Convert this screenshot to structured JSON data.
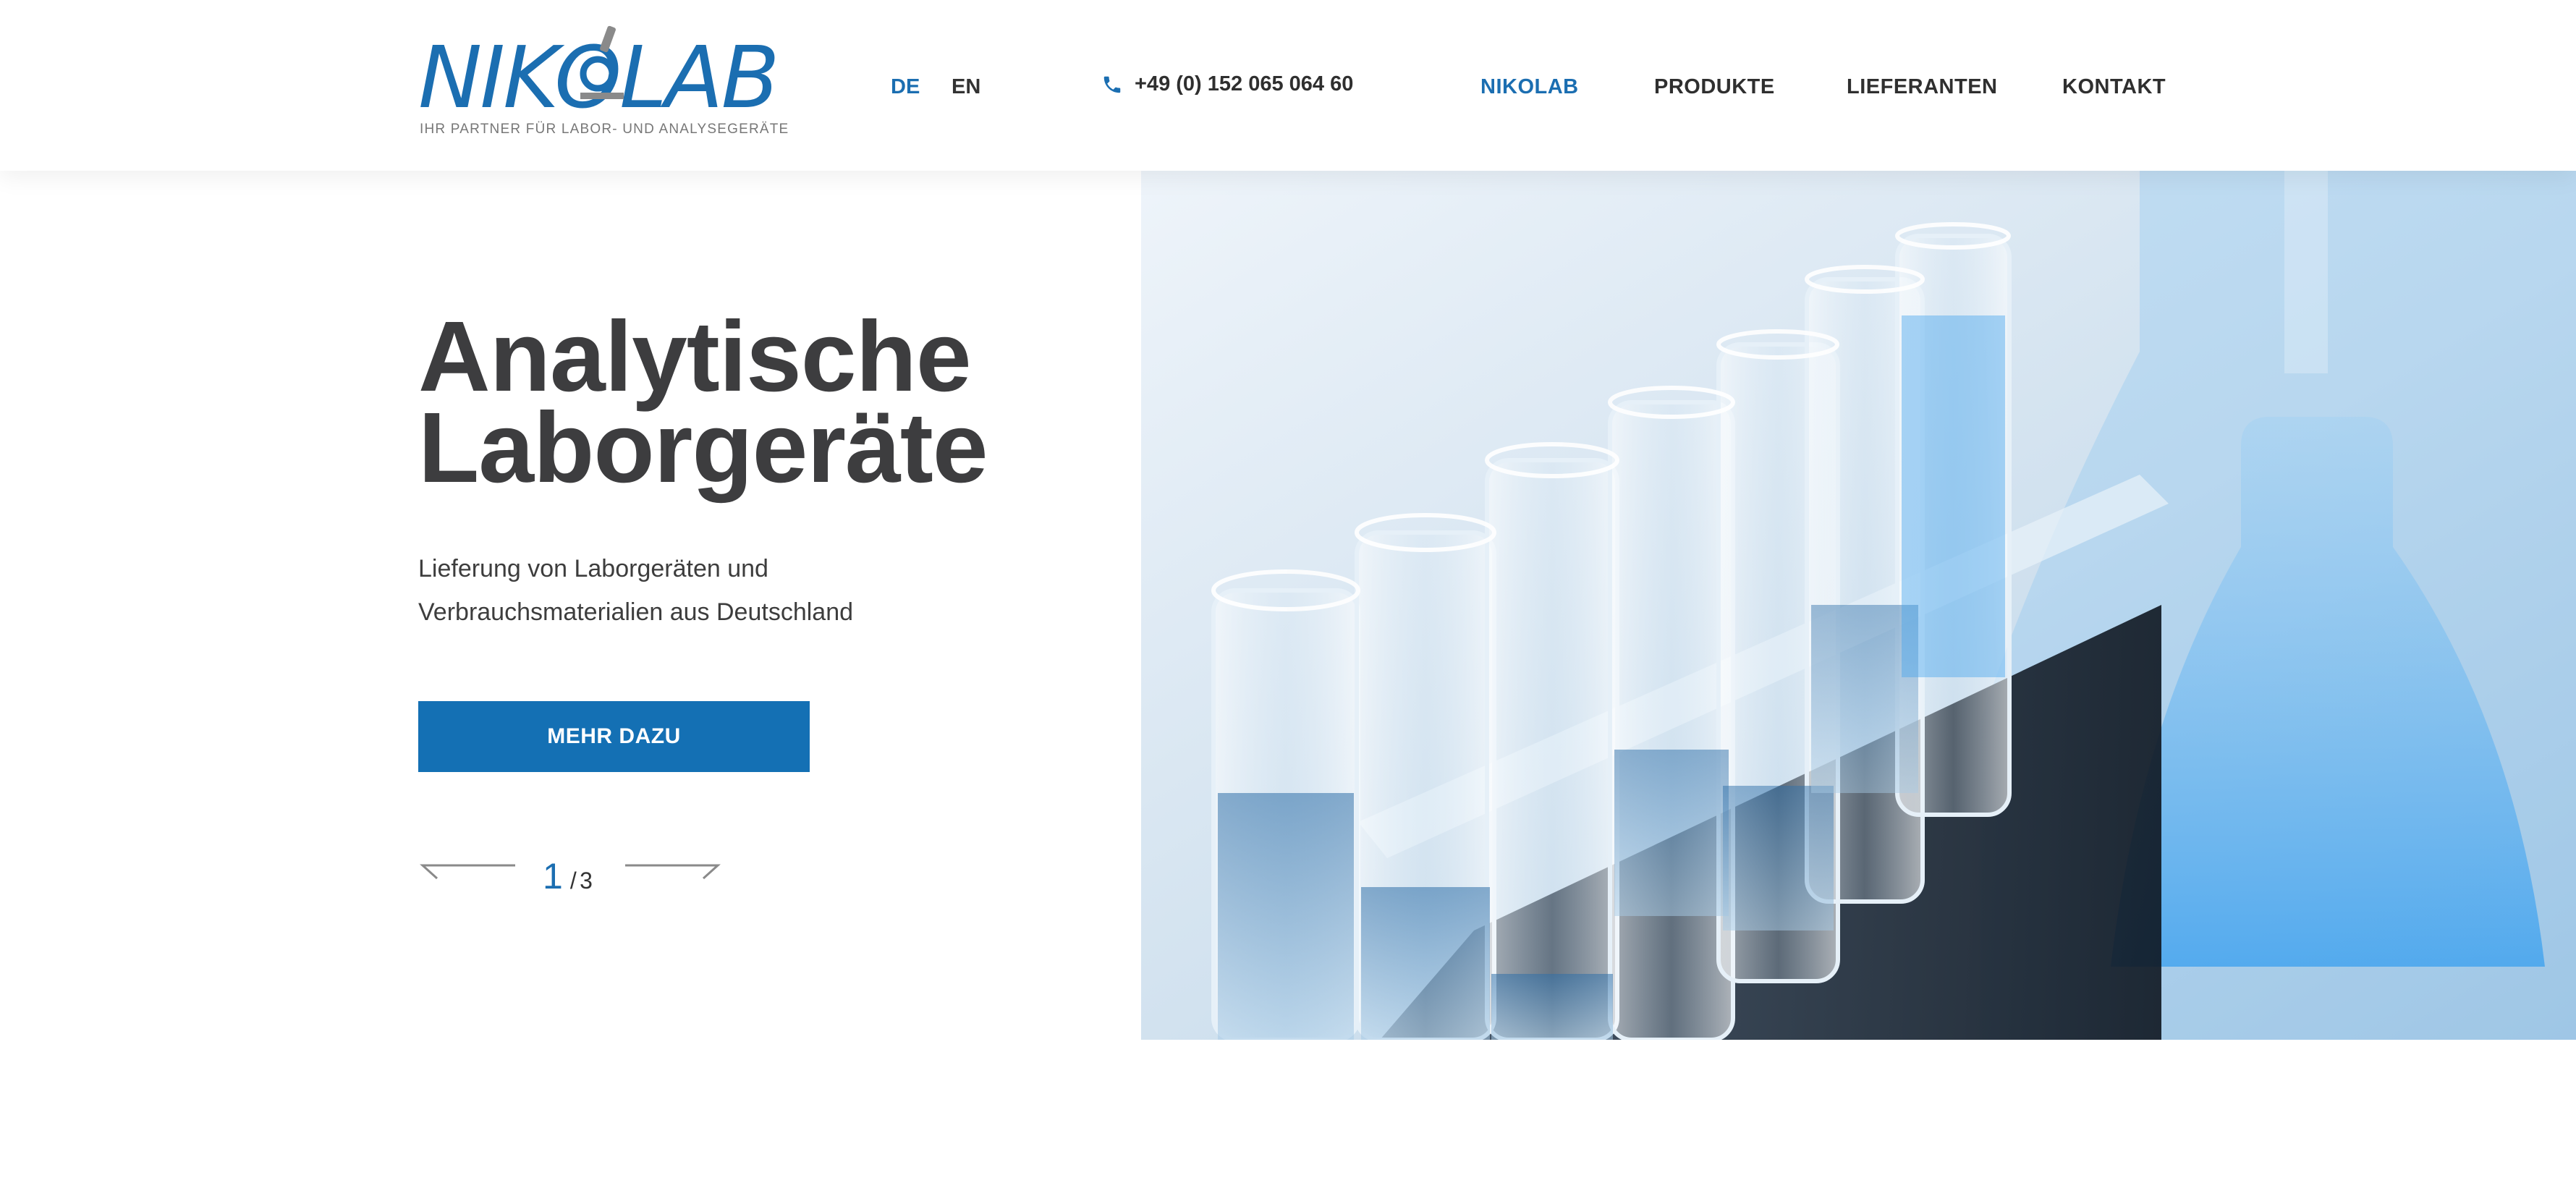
{
  "header": {
    "logo": {
      "wordmark": "NIKOLAB",
      "tagline": "IHR PARTNER FÜR LABOR- UND ANALYSEGERÄTE"
    },
    "languages": [
      {
        "label": "DE",
        "active": true
      },
      {
        "label": "EN",
        "active": false
      }
    ],
    "phone": {
      "icon": "phone-icon",
      "number": "+49 (0) 152 065 064 60"
    },
    "nav": [
      {
        "label": "NIKOLAB",
        "active": true
      },
      {
        "label": "PRODUKTE",
        "active": false
      },
      {
        "label": "LIEFERANTEN",
        "active": false
      },
      {
        "label": "KONTAKT",
        "active": false
      }
    ]
  },
  "hero": {
    "title_lines": [
      "Analytische",
      "Laborgeräte"
    ],
    "subtitle_lines": [
      "Lieferung von Laborgeräten und",
      "Verbrauchsmaterialien aus Deutschland"
    ],
    "cta_label": "MEHR DAZU",
    "slider": {
      "current": "1",
      "separator": "/",
      "total": "3"
    },
    "image": {
      "subject": "test-tubes-in-rack-with-blue-liquid"
    }
  },
  "colors": {
    "brand_blue": "#1b6eb1",
    "button_blue": "#1470b4",
    "text_dark": "#3d3d3f",
    "tagline_gray": "#777777"
  }
}
